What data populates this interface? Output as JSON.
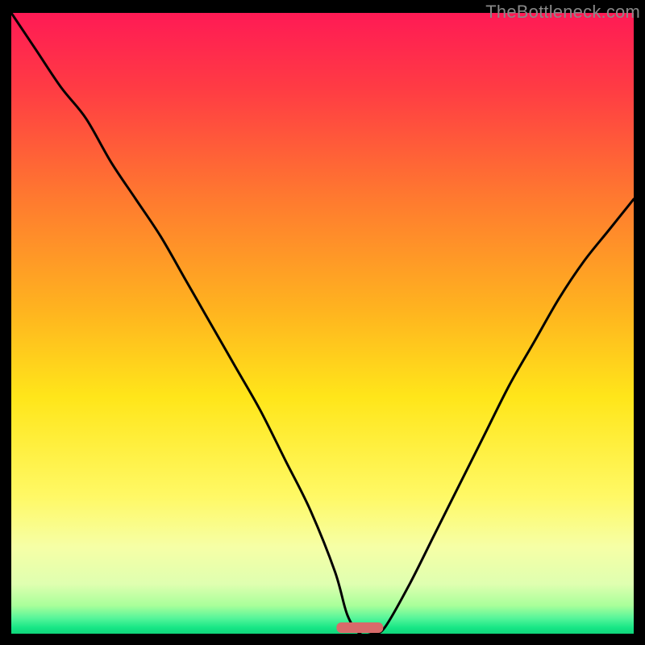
{
  "watermark": "TheBottleneck.com",
  "chart_data": {
    "type": "line",
    "title": "",
    "xlabel": "",
    "ylabel": "",
    "xlim": [
      0,
      100
    ],
    "ylim": [
      0,
      100
    ],
    "background_gradient": [
      {
        "stop": 0.0,
        "color": "#ff1a55"
      },
      {
        "stop": 0.12,
        "color": "#ff3b44"
      },
      {
        "stop": 0.3,
        "color": "#ff7a2f"
      },
      {
        "stop": 0.48,
        "color": "#ffb41f"
      },
      {
        "stop": 0.62,
        "color": "#ffe61a"
      },
      {
        "stop": 0.78,
        "color": "#fff966"
      },
      {
        "stop": 0.86,
        "color": "#f6ffa6"
      },
      {
        "stop": 0.92,
        "color": "#dfffb0"
      },
      {
        "stop": 0.955,
        "color": "#a8ff9a"
      },
      {
        "stop": 0.975,
        "color": "#56f59a"
      },
      {
        "stop": 0.99,
        "color": "#18e786"
      },
      {
        "stop": 1.0,
        "color": "#0fd47a"
      }
    ],
    "series": [
      {
        "name": "bottleneck-curve",
        "x": [
          0,
          4,
          8,
          12,
          16,
          20,
          24,
          28,
          32,
          36,
          40,
          44,
          48,
          52,
          54,
          56,
          58,
          60,
          64,
          68,
          72,
          76,
          80,
          84,
          88,
          92,
          96,
          100
        ],
        "values": [
          100,
          94,
          88,
          83,
          76,
          70,
          64,
          57,
          50,
          43,
          36,
          28,
          20,
          10,
          3,
          0,
          0,
          1,
          8,
          16,
          24,
          32,
          40,
          47,
          54,
          60,
          65,
          70
        ]
      }
    ],
    "marker": {
      "name": "optimal-range",
      "x_center": 56,
      "width": 7.5,
      "color": "#d86a6a"
    }
  }
}
